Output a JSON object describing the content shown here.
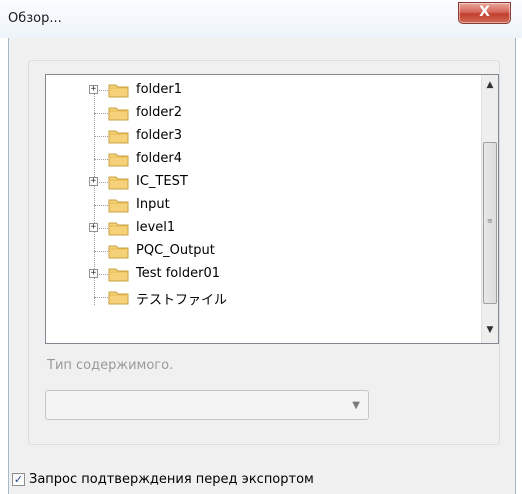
{
  "window": {
    "title": "Обзор...",
    "close_glyph": "X"
  },
  "tree": {
    "items": [
      {
        "label": "folder1",
        "expandable": true
      },
      {
        "label": "folder2",
        "expandable": false
      },
      {
        "label": "folder3",
        "expandable": false
      },
      {
        "label": "folder4",
        "expandable": false
      },
      {
        "label": "IC_TEST",
        "expandable": true
      },
      {
        "label": "Input",
        "expandable": false
      },
      {
        "label": "level1",
        "expandable": true
      },
      {
        "label": "PQC_Output",
        "expandable": false
      },
      {
        "label": "Test folder01",
        "expandable": true
      },
      {
        "label": "テストファイル",
        "expandable": false
      }
    ],
    "expander_glyph": "+",
    "scroll_up_glyph": "▲",
    "scroll_down_glyph": "▼",
    "thumb_grip_glyph": "≡"
  },
  "content_type": {
    "label": "Тип содержимого.",
    "value": "",
    "arrow_glyph": "▼"
  },
  "confirm_export": {
    "label": "Запрос подтверждения перед экспортом",
    "checked": true,
    "check_glyph": "✓"
  },
  "colors": {
    "folder_fill": "#f5d27a",
    "folder_edge": "#c9a043"
  }
}
